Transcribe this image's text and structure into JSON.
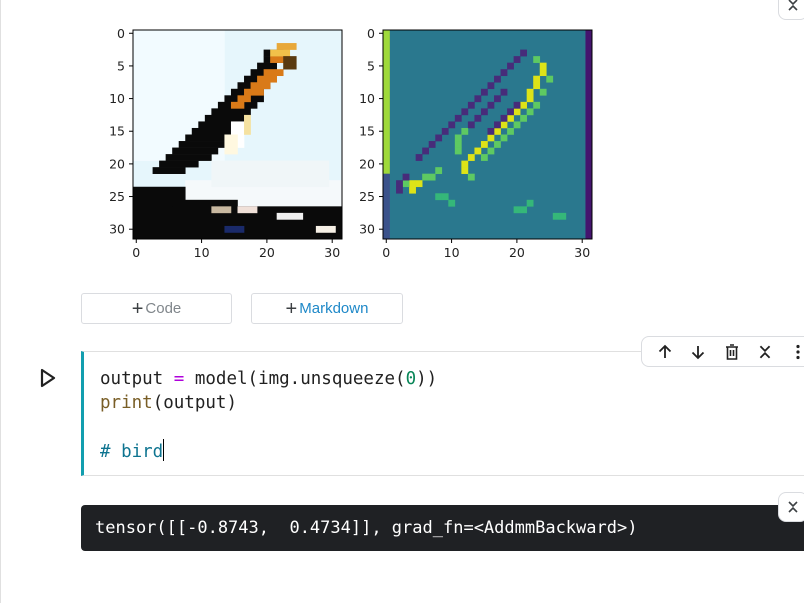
{
  "plots": {
    "left": {
      "y_ticks": [
        "0",
        "5",
        "10",
        "15",
        "20",
        "25",
        "30"
      ],
      "x_ticks": [
        "0",
        "10",
        "20",
        "30"
      ]
    },
    "right": {
      "y_ticks": [
        "0",
        "5",
        "10",
        "15",
        "20",
        "25",
        "30"
      ],
      "x_ticks": [
        "0",
        "10",
        "20",
        "30"
      ]
    }
  },
  "add_buttons": {
    "code_label": "Code",
    "markdown_label": "Markdown"
  },
  "code_cell": {
    "line1_a": "output ",
    "line1_op": "=",
    "line1_b": " model(img.unsqueeze(",
    "line1_num": "0",
    "line1_c": "))",
    "line2_fn": "print",
    "line2_rest": "(output)",
    "line4_comment": "# bird"
  },
  "output": {
    "text": "tensor([[-0.8743,  0.4734]], grad_fn=<AddmmBackward>)"
  },
  "toolbar": {
    "icons": [
      "arrow-up-icon",
      "arrow-down-icon",
      "trash-icon",
      "collapse-icon",
      "more-vert-icon"
    ]
  },
  "colors": {
    "cell_accent": "#129eaf",
    "output_bg": "#1f2124",
    "markdown_link": "#1e88c8"
  }
}
